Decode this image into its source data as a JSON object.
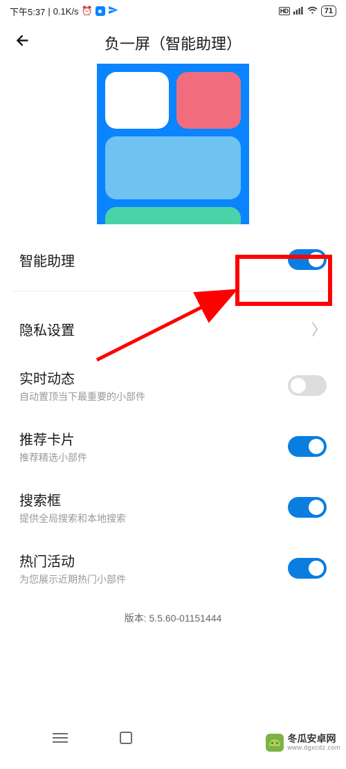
{
  "status": {
    "time": "下午5:37",
    "speed": "0.1K/s",
    "battery": "71"
  },
  "header": {
    "title": "负一屏（智能助理）"
  },
  "rows": {
    "assistant": {
      "title": "智能助理",
      "on": true
    },
    "privacy": {
      "title": "隐私设置"
    },
    "live": {
      "title": "实时动态",
      "sub": "自动置顶当下最重要的小部件",
      "on": false
    },
    "cards": {
      "title": "推荐卡片",
      "sub": "推荐精选小部件",
      "on": true
    },
    "search": {
      "title": "搜索框",
      "sub": "提供全局搜索和本地搜索",
      "on": true
    },
    "hot": {
      "title": "热门活动",
      "sub": "为您展示近期热门小部件",
      "on": true
    }
  },
  "version": "版本: 5.5.60-01151444",
  "watermark": {
    "cn": "冬瓜安卓网",
    "en": "www.dgxcdz.com"
  }
}
